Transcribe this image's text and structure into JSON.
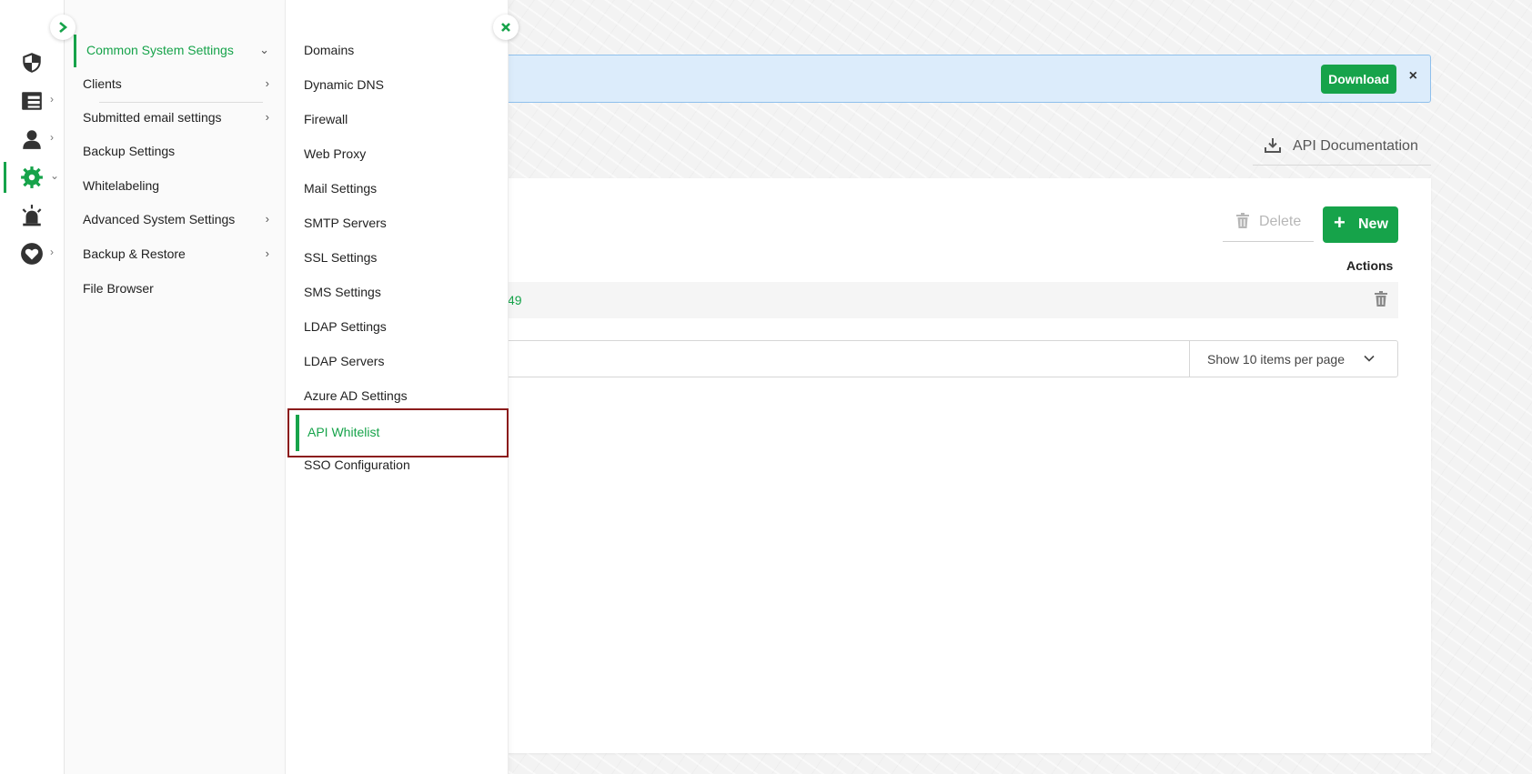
{
  "colors": {
    "accent": "#16a34a",
    "highlight_border": "#8b1c1c",
    "banner_bg": "#dcecfb"
  },
  "rail": {
    "items": [
      {
        "icon": "shield-icon",
        "has_chevron": false
      },
      {
        "icon": "dashboard-icon",
        "has_chevron": true
      },
      {
        "icon": "user-icon",
        "has_chevron": true
      },
      {
        "icon": "gear-icon",
        "has_chevron": true,
        "active": true
      },
      {
        "icon": "alarm-icon",
        "has_chevron": false
      },
      {
        "icon": "heart-icon",
        "has_chevron": true
      }
    ],
    "chevron_right": "›",
    "chevron_down": "⌄"
  },
  "menu1": {
    "items": [
      {
        "label": "Common System Settings",
        "arrow": "⌄",
        "active": true
      },
      {
        "label": "Clients",
        "arrow": "›"
      },
      {
        "label": "Submitted email settings",
        "arrow": "›"
      },
      {
        "label": "Backup Settings",
        "arrow": ""
      },
      {
        "label": "Whitelabeling",
        "arrow": ""
      },
      {
        "label": "Advanced System Settings",
        "arrow": "›"
      },
      {
        "label": "Backup & Restore",
        "arrow": "›"
      },
      {
        "label": "File Browser",
        "arrow": ""
      }
    ]
  },
  "menu2": {
    "items": [
      {
        "label": "Domains"
      },
      {
        "label": "Dynamic DNS"
      },
      {
        "label": "Firewall"
      },
      {
        "label": "Web Proxy"
      },
      {
        "label": "Mail Settings"
      },
      {
        "label": "SMTP Servers"
      },
      {
        "label": "SSL Settings"
      },
      {
        "label": "SMS Settings"
      },
      {
        "label": "LDAP Settings"
      },
      {
        "label": "LDAP Servers"
      },
      {
        "label": "Azure AD Settings"
      },
      {
        "label": "API Whitelist",
        "active": true
      },
      {
        "label": "SSO Configuration"
      }
    ]
  },
  "banner": {
    "download_label": "Download",
    "close_label": "×"
  },
  "toolbar": {
    "api_doc_label": "API Documentation",
    "delete_label": "Delete",
    "new_label": "New",
    "new_plus": "+"
  },
  "table": {
    "actions_header": "Actions",
    "rows": [
      {
        "value": "49"
      }
    ]
  },
  "pager": {
    "per_page_label": "Show 10 items per page"
  }
}
